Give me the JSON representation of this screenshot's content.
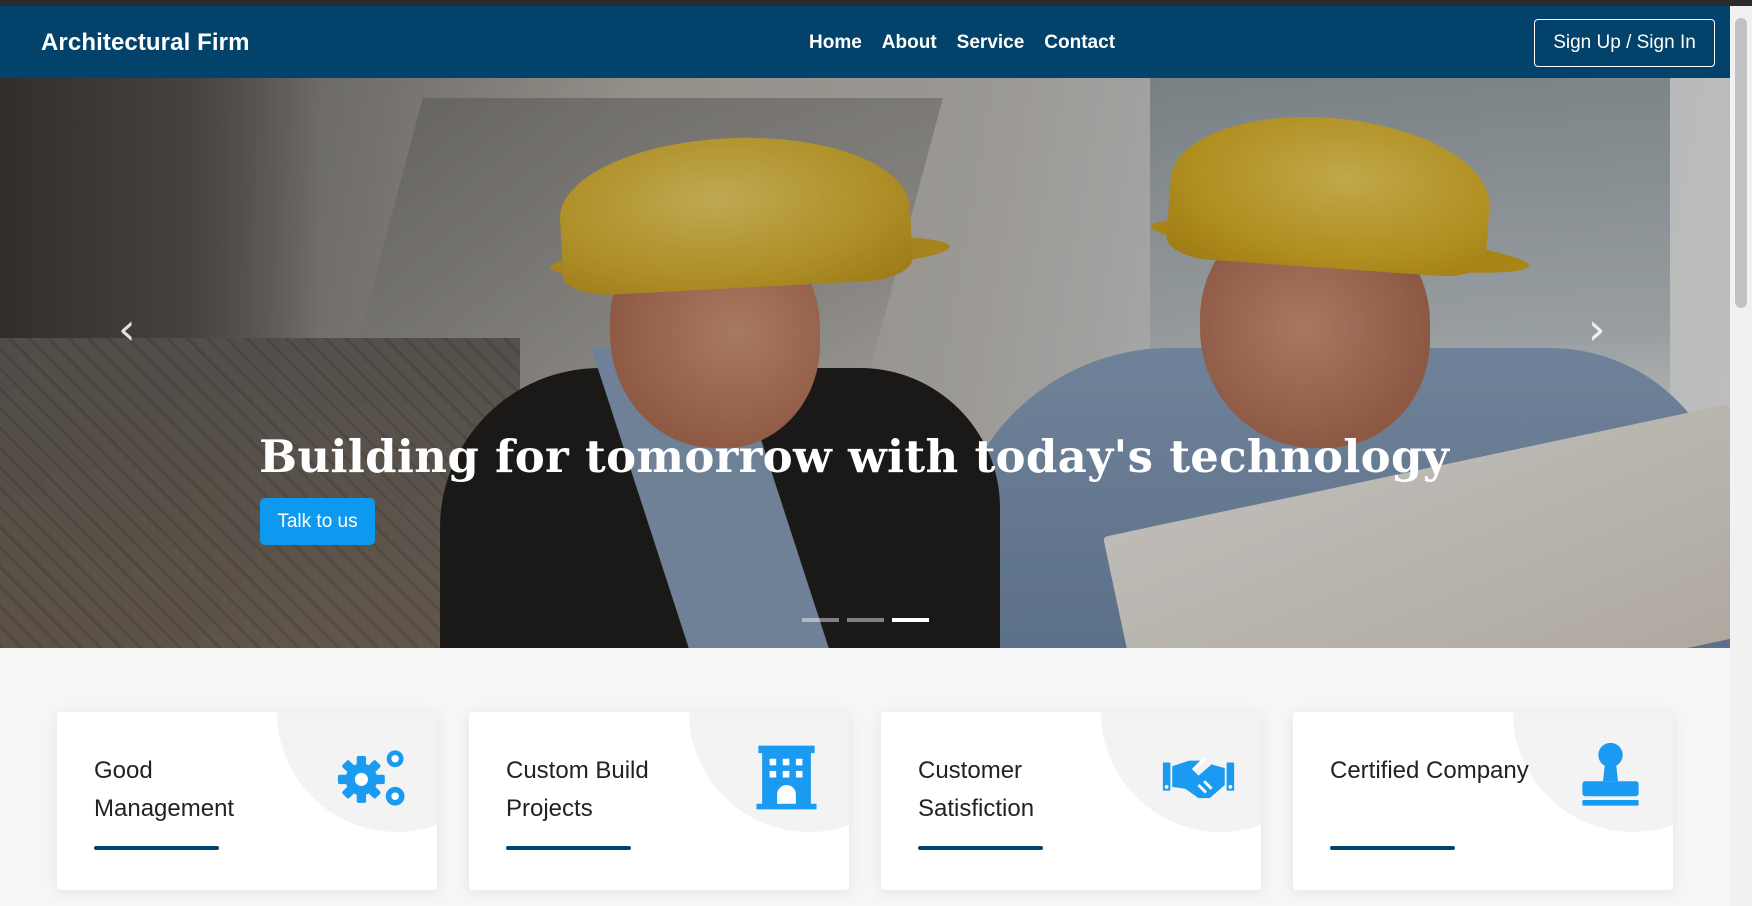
{
  "navbar": {
    "brand": "Architectural Firm",
    "links": [
      "Home",
      "About",
      "Service",
      "Contact"
    ],
    "signin_label": "Sign Up / Sign In"
  },
  "hero": {
    "heading": "Building for tomorrow with today's technology",
    "button_label": "Talk to us",
    "prev_arrow": "‹",
    "next_arrow": "›",
    "slide_count": 3,
    "active_slide": 3
  },
  "features": [
    {
      "title": "Good Management",
      "icon": "gears-icon"
    },
    {
      "title": "Custom Build Projects",
      "icon": "building-icon"
    },
    {
      "title": "Customer Satisfiction",
      "icon": "handshake-icon"
    },
    {
      "title": "Certified Company",
      "icon": "stamp-icon"
    }
  ],
  "colors": {
    "navbar": "#03426b",
    "accent": "#0d99f0",
    "icon": "#1a9af0"
  }
}
